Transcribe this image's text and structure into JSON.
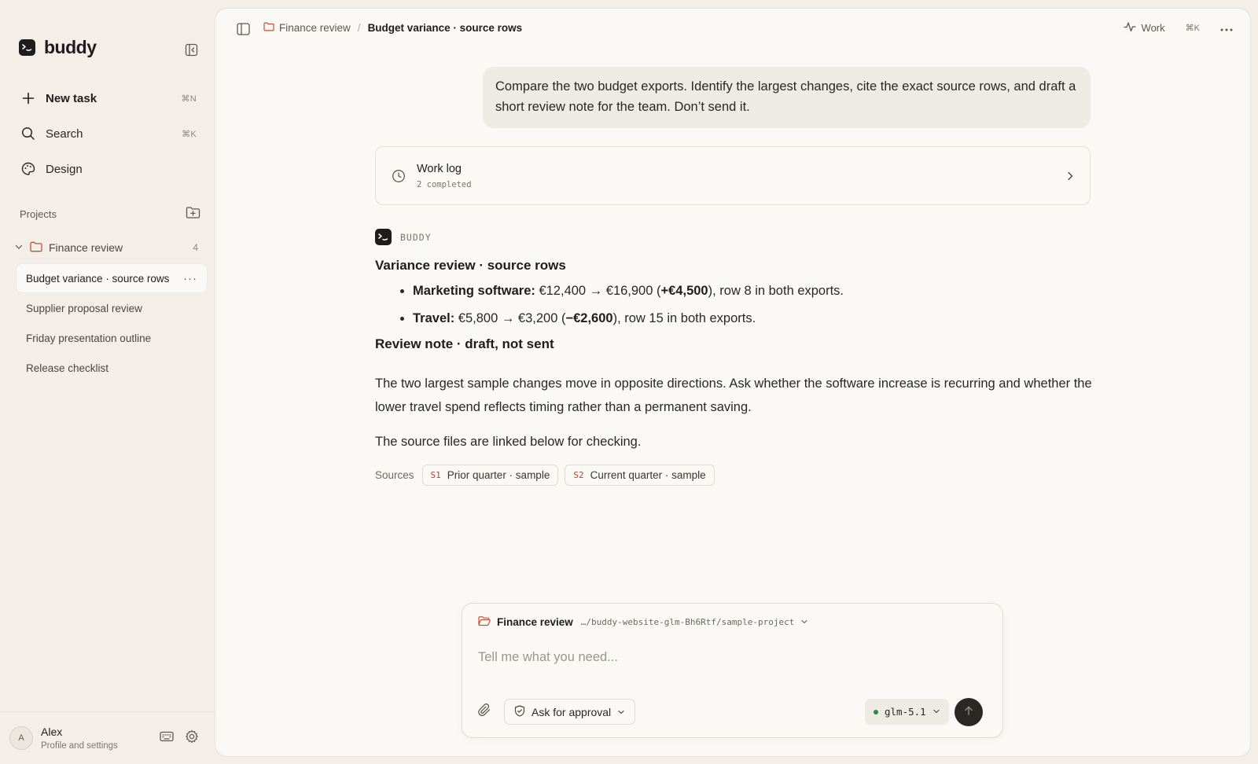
{
  "sidebar": {
    "brand": "buddy",
    "nav": [
      {
        "label": "New task",
        "shortcut": "⌘N",
        "icon": "plus-icon"
      },
      {
        "label": "Search",
        "shortcut": "⌘K",
        "icon": "search-icon"
      },
      {
        "label": "Design",
        "shortcut": "",
        "icon": "palette-icon"
      }
    ],
    "projects_label": "Projects",
    "project": {
      "name": "Finance review",
      "count": "4"
    },
    "tasks": [
      {
        "label": "Budget variance · source rows",
        "active": true
      },
      {
        "label": "Supplier proposal review"
      },
      {
        "label": "Friday presentation outline"
      },
      {
        "label": "Release checklist"
      }
    ],
    "profile": {
      "initial": "A",
      "name": "Alex",
      "subtitle": "Profile and settings"
    }
  },
  "topbar": {
    "breadcrumb_project": "Finance review",
    "breadcrumb_sep": "/",
    "breadcrumb_current": "Budget variance · source rows",
    "work_label": "Work",
    "shortcut": "⌘K"
  },
  "conversation": {
    "user_message": "Compare the two budget exports. Identify the largest changes, cite the exact source rows, and draft a short review note for the team. Don’t send it.",
    "worklog": {
      "title": "Work log",
      "subtitle": "2 completed"
    },
    "assistant": {
      "name": "BUDDY",
      "heading1": "Variance review · source rows",
      "bullets": [
        {
          "label": "Marketing software:",
          "pre": " €12,400 → €16,900 (",
          "delta": "+€4,500",
          "post": "), row 8 in both exports."
        },
        {
          "label": "Travel:",
          "pre": " €5,800 → €3,200 (",
          "delta": "−€2,600",
          "post": "), row 15 in both exports."
        }
      ],
      "heading2": "Review note · draft, not sent",
      "para1": "The two largest sample changes move in opposite directions. Ask whether the software increase is recurring and whether the lower travel spend reflects timing rather than a permanent saving.",
      "para2": "The source files are linked below for checking.",
      "sources_label": "Sources",
      "sources": [
        {
          "tag": "S1",
          "label": "Prior quarter · sample"
        },
        {
          "tag": "S2",
          "label": "Current quarter · sample"
        }
      ]
    }
  },
  "composer": {
    "project": "Finance review",
    "path": "…/buddy-website-glm-Bh6Rtf/sample-project",
    "placeholder": "Tell me what you need...",
    "approval_label": "Ask for approval",
    "model": "glm-5.1"
  },
  "colors": {
    "background": "#f3efe8",
    "panel": "#fbf9f6",
    "accent_folder": "#c0503a",
    "model_status": "#2f8a3e",
    "send_button": "#2a2724"
  }
}
